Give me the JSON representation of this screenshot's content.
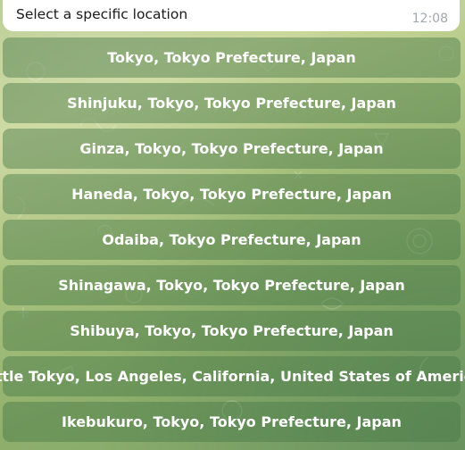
{
  "message": {
    "text": "Select a specific location",
    "time": "12:08"
  },
  "keyboard": {
    "buttons": [
      "Tokyo, Tokyo Prefecture, Japan",
      "Shinjuku, Tokyo, Tokyo Prefecture, Japan",
      "Ginza, Tokyo, Tokyo Prefecture, Japan",
      "Haneda, Tokyo, Tokyo Prefecture, Japan",
      "Odaiba, Tokyo Prefecture, Japan",
      "Shinagawa, Tokyo, Tokyo Prefecture, Japan",
      "Shibuya, Tokyo, Tokyo Prefecture, Japan",
      "Little Tokyo, Los Angeles, California, United States of America",
      "Ikebukuro, Tokyo, Tokyo Prefecture, Japan"
    ]
  },
  "colors": {
    "button_bg": "#4a7a48",
    "bubble_bg": "#ffffff",
    "time_text": "#a0a8ae"
  }
}
